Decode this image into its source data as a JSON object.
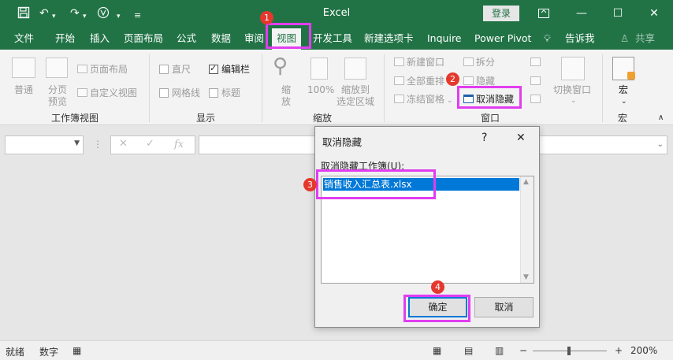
{
  "titlebar": {
    "title": "Excel",
    "login": "登录",
    "icons": [
      "save-icon",
      "undo-icon",
      "redo-icon",
      "touch-mode-icon",
      "customize-icon",
      "ribbon-display-icon",
      "minimize-icon",
      "maximize-icon",
      "close-icon"
    ]
  },
  "menu": {
    "tabs": [
      "文件",
      "开始",
      "插入",
      "页面布局",
      "公式",
      "数据",
      "审阅",
      "视图",
      "开发工具",
      "新建选项卡",
      "Inquire",
      "Power Pivot",
      "告诉我",
      "共享"
    ],
    "active_tab": "视图"
  },
  "ribbon": {
    "workbook_views": {
      "normal": "普通",
      "page_break": "分页\n预览",
      "page_break_line1": "分页",
      "page_break_line2": "预览",
      "page_layout": "页面布局",
      "custom_views": "自定义视图",
      "label": "工作簿视图"
    },
    "show": {
      "ruler": "直尺",
      "formula_bar": "编辑栏",
      "gridlines": "网格线",
      "headings": "标题",
      "label": "显示",
      "formula_bar_checked": true
    },
    "zoom": {
      "zoom_line1": "缩",
      "zoom_line2": "放",
      "hundred": "100%",
      "zoom_sel_line1": "缩放到",
      "zoom_sel_line2": "选定区域",
      "label": "缩放"
    },
    "window": {
      "new_window": "新建窗口",
      "arrange_all": "全部重排",
      "freeze_panes": "冻结窗格",
      "split": "拆分",
      "hide": "隐藏",
      "unhide": "取消隐藏",
      "switch_windows": "切换窗口",
      "label": "窗口"
    },
    "macros": {
      "macro": "宏",
      "label": "宏"
    }
  },
  "formula_bar": {
    "fx": "fx"
  },
  "dialog": {
    "title": "取消隐藏",
    "help": "?",
    "close": "✕",
    "list_label": "取消隐藏工作簿(U):",
    "items": [
      "销售收入汇总表.xlsx"
    ],
    "ok": "确定",
    "cancel": "取消"
  },
  "annotations": [
    "1",
    "2",
    "3",
    "4"
  ],
  "statusbar": {
    "ready": "就绪",
    "num": "数字",
    "zoom_level": "200%"
  },
  "colors": {
    "excel_green": "#217346",
    "highlight": "#e13df0",
    "badge": "#e5382d",
    "selection": "#0078d7"
  }
}
